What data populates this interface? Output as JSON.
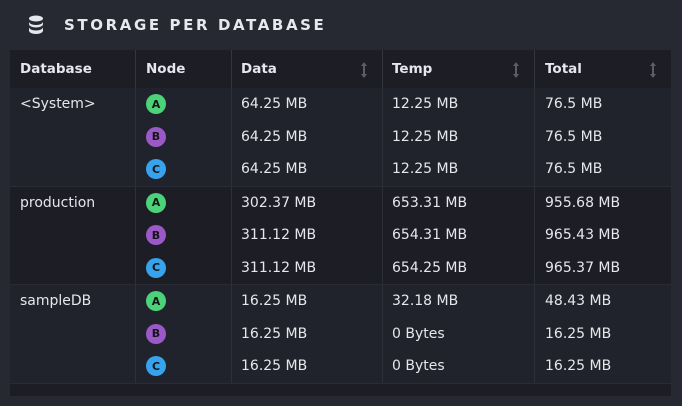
{
  "panel": {
    "title": "STORAGE PER DATABASE",
    "icon": "database-icon"
  },
  "columns": {
    "database": "Database",
    "node": "Node",
    "data": "Data",
    "temp": "Temp",
    "total": "Total"
  },
  "rows": [
    {
      "database": "<System>",
      "node": "A",
      "data": "64.25 MB",
      "temp": "12.25 MB",
      "total": "76.5 MB"
    },
    {
      "database": "",
      "node": "B",
      "data": "64.25 MB",
      "temp": "12.25 MB",
      "total": "76.5 MB"
    },
    {
      "database": "",
      "node": "C",
      "data": "64.25 MB",
      "temp": "12.25 MB",
      "total": "76.5 MB"
    },
    {
      "database": "production",
      "node": "A",
      "data": "302.37 MB",
      "temp": "653.31 MB",
      "total": "955.68 MB"
    },
    {
      "database": "",
      "node": "B",
      "data": "311.12 MB",
      "temp": "654.31 MB",
      "total": "965.43 MB"
    },
    {
      "database": "",
      "node": "C",
      "data": "311.12 MB",
      "temp": "654.25 MB",
      "total": "965.37 MB"
    },
    {
      "database": "sampleDB",
      "node": "A",
      "data": "16.25 MB",
      "temp": "32.18 MB",
      "total": "48.43 MB"
    },
    {
      "database": "",
      "node": "B",
      "data": "16.25 MB",
      "temp": "0 Bytes",
      "total": "16.25 MB"
    },
    {
      "database": "",
      "node": "C",
      "data": "16.25 MB",
      "temp": "0 Bytes",
      "total": "16.25 MB"
    }
  ],
  "colors": {
    "node_a": "#4cd37a",
    "node_b": "#9b59c7",
    "node_c": "#36a3ec",
    "background": "#262832",
    "table_bg": "#1c1d25"
  }
}
